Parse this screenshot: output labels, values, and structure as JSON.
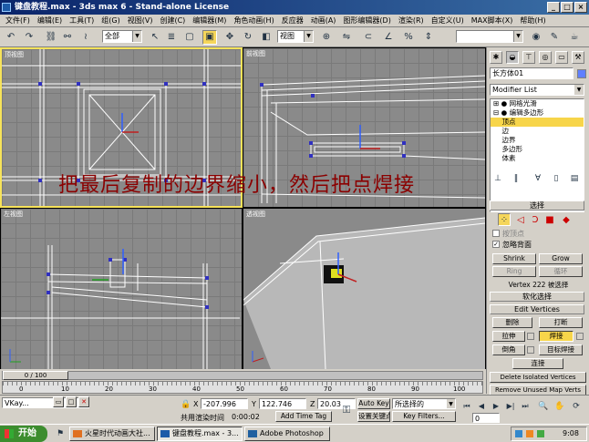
{
  "window": {
    "title": "键盘教程.max - 3ds max 6 - Stand-alone License"
  },
  "menu": [
    "文件(F)",
    "编辑(E)",
    "工具(T)",
    "组(G)",
    "视图(V)",
    "创建(C)",
    "编辑器(M)",
    "角色动画(H)",
    "反应器",
    "动画(A)",
    "图形编辑器(D)",
    "渲染(R)",
    "自定义(U)",
    "MAX脚本(X)",
    "帮助(H)"
  ],
  "toolbar": {
    "selection_filter": "全部",
    "coord_system": "视图"
  },
  "viewports": {
    "top": "顶视图",
    "front": "前视图",
    "left": "左视图",
    "perspective": "透视图"
  },
  "overlay_caption": "把最后复制的边界缩小，然后把点焊接",
  "command_panel": {
    "object_name": "长方体01",
    "modifier_list": "Modifier List",
    "stack": [
      "网格光滑",
      "编辑多边形",
      "顶点",
      "边",
      "边界",
      "多边形",
      "体素"
    ],
    "selected_stack_index": 2,
    "selection_rollout": {
      "title": "选择",
      "by_vertex": "按顶点",
      "ignore_backfacing": "忽略背面",
      "shrink": "Shrink",
      "grow": "Grow",
      "ring": "Ring",
      "loop": "循环",
      "status": "Vertex 222 被选择"
    },
    "soft_selection_title": "软化选择",
    "edit_vertices": {
      "title": "Edit Vertices",
      "remove": "删除",
      "break": "打断",
      "extrude": "拉伸",
      "weld": "焊接",
      "chamfer": "倒角",
      "target_weld": "目标焊接",
      "connect": "连接",
      "remove_isolated": "Delete Isolated Vertices",
      "remove_unused_map": "Remove Unused Map Verts"
    }
  },
  "timeline": {
    "frame_display": "0 / 100",
    "ticks": [
      "0",
      "10",
      "20",
      "30",
      "40",
      "50",
      "60",
      "70",
      "80",
      "90",
      "100"
    ]
  },
  "status": {
    "maxscript": "VKay...",
    "coords_x": "-207.996",
    "coords_y": "122.746",
    "coords_z": "20.03",
    "render_time_label": "共用渲染时间",
    "render_time": "0:00:02",
    "add_time_tag": "Add Time Tag",
    "auto_key": "Auto Key",
    "set_key": "设置关键点",
    "key_filters": "Key Filters...",
    "key_mode": "所选择的",
    "frame": "0"
  },
  "taskbar": {
    "start": "开始",
    "tasks": [
      "火星时代动画大社...",
      "键盘教程.max - 3...",
      "Adobe Photoshop"
    ],
    "clock": "9:08"
  }
}
